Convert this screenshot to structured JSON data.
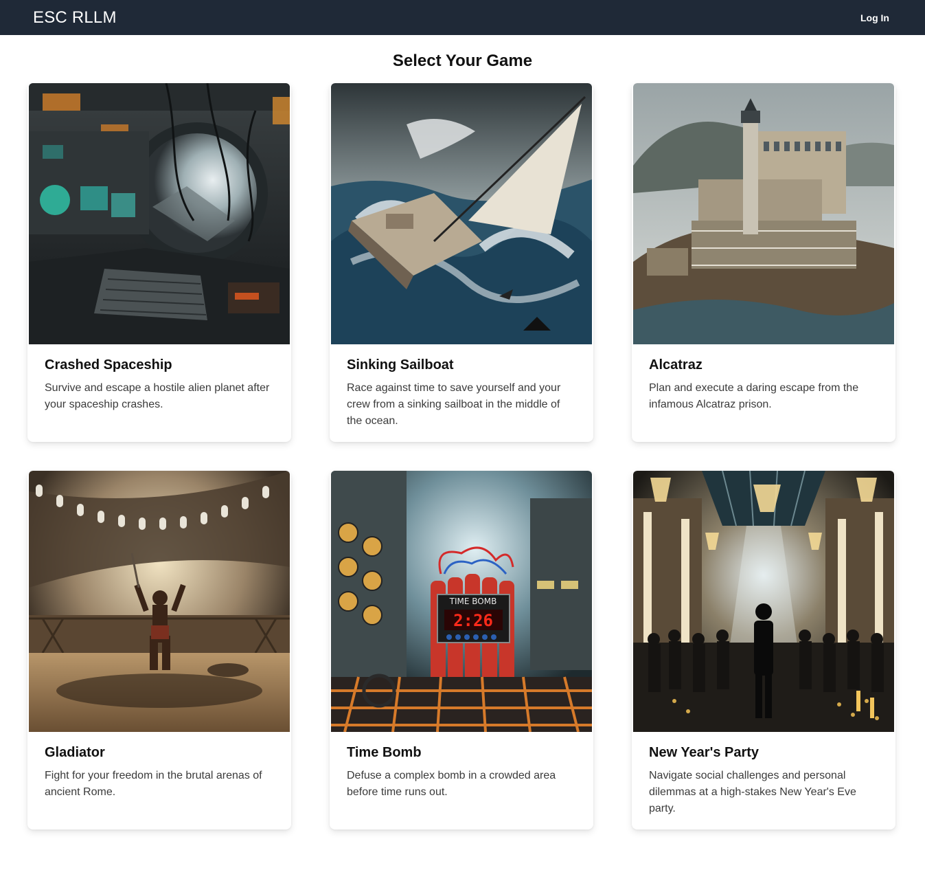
{
  "header": {
    "brand": "ESC RLLM",
    "login_label": "Log In"
  },
  "page": {
    "title": "Select Your Game"
  },
  "games": [
    {
      "title": "Crashed Spaceship",
      "description": "Survive and escape a hostile alien planet after your spaceship crashes.",
      "image": "crashed-spaceship-image"
    },
    {
      "title": "Sinking Sailboat",
      "description": "Race against time to save yourself and your crew from a sinking sailboat in the middle of the ocean.",
      "image": "sinking-sailboat-image"
    },
    {
      "title": "Alcatraz",
      "description": "Plan and execute a daring escape from the infamous Alcatraz prison.",
      "image": "alcatraz-image"
    },
    {
      "title": "Gladiator",
      "description": "Fight for your freedom in the brutal arenas of ancient Rome.",
      "image": "gladiator-image"
    },
    {
      "title": "Time Bomb",
      "description": "Defuse a complex bomb in a crowded area before time runs out.",
      "image": "time-bomb-image",
      "image_text": {
        "label": "TIME BOMB",
        "timer": "2:26"
      }
    },
    {
      "title": "New Year's Party",
      "description": "Navigate social challenges and personal dilemmas at a high-stakes New Year's Eve party.",
      "image": "new-years-party-image"
    }
  ],
  "colors": {
    "navbar": "#1f2937",
    "text": "#111111",
    "muted": "#3a3a3a"
  }
}
